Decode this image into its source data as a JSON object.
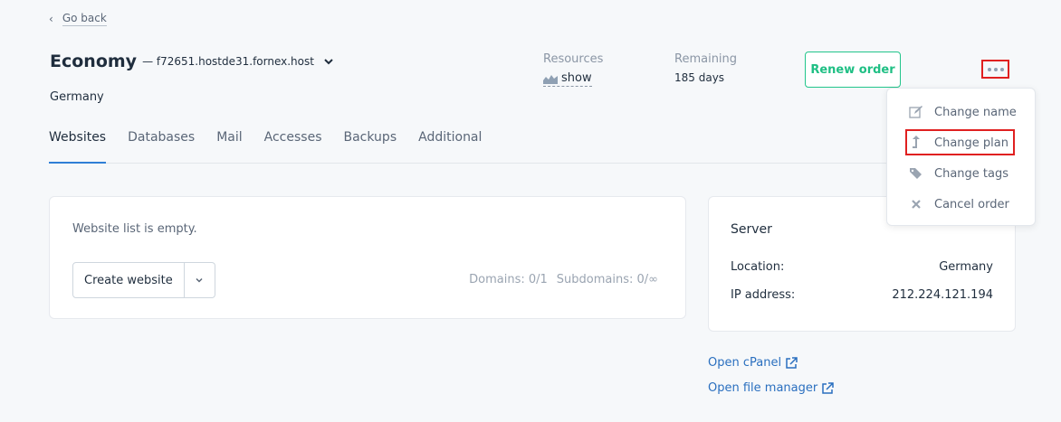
{
  "nav": {
    "back_label": "Go back"
  },
  "header": {
    "plan_name": "Economy",
    "host": "— f72651.hostde31.fornex.host",
    "country": "Germany"
  },
  "stats": {
    "resources_label": "Resources",
    "resources_value": "show",
    "remaining_label": "Remaining",
    "remaining_value": "185 days"
  },
  "actions": {
    "renew_label": "Renew order"
  },
  "tabs": [
    {
      "label": "Websites",
      "active": true
    },
    {
      "label": "Databases"
    },
    {
      "label": "Mail"
    },
    {
      "label": "Accesses"
    },
    {
      "label": "Backups"
    },
    {
      "label": "Additional"
    }
  ],
  "websites": {
    "empty_text": "Website list is empty.",
    "create_label": "Create website",
    "domains": "Domains: 0/1",
    "subdomains": "Subdomains: 0/∞"
  },
  "server": {
    "title": "Server",
    "location_label": "Location:",
    "location_value": "Germany",
    "ip_label": "IP address:",
    "ip_value": "212.224.121.194"
  },
  "links": {
    "cpanel": "Open cPanel",
    "file_manager": "Open file manager"
  },
  "menu": {
    "items": [
      {
        "label": "Change name",
        "icon": "edit-icon"
      },
      {
        "label": "Change plan",
        "icon": "upgrade-icon"
      },
      {
        "label": "Change tags",
        "icon": "tags-icon"
      },
      {
        "label": "Cancel order",
        "icon": "close-icon"
      }
    ]
  },
  "colors": {
    "accent": "#22c58b",
    "link": "#2a6fbf",
    "tab_active": "#2f7fd6",
    "highlight": "#e02020"
  }
}
